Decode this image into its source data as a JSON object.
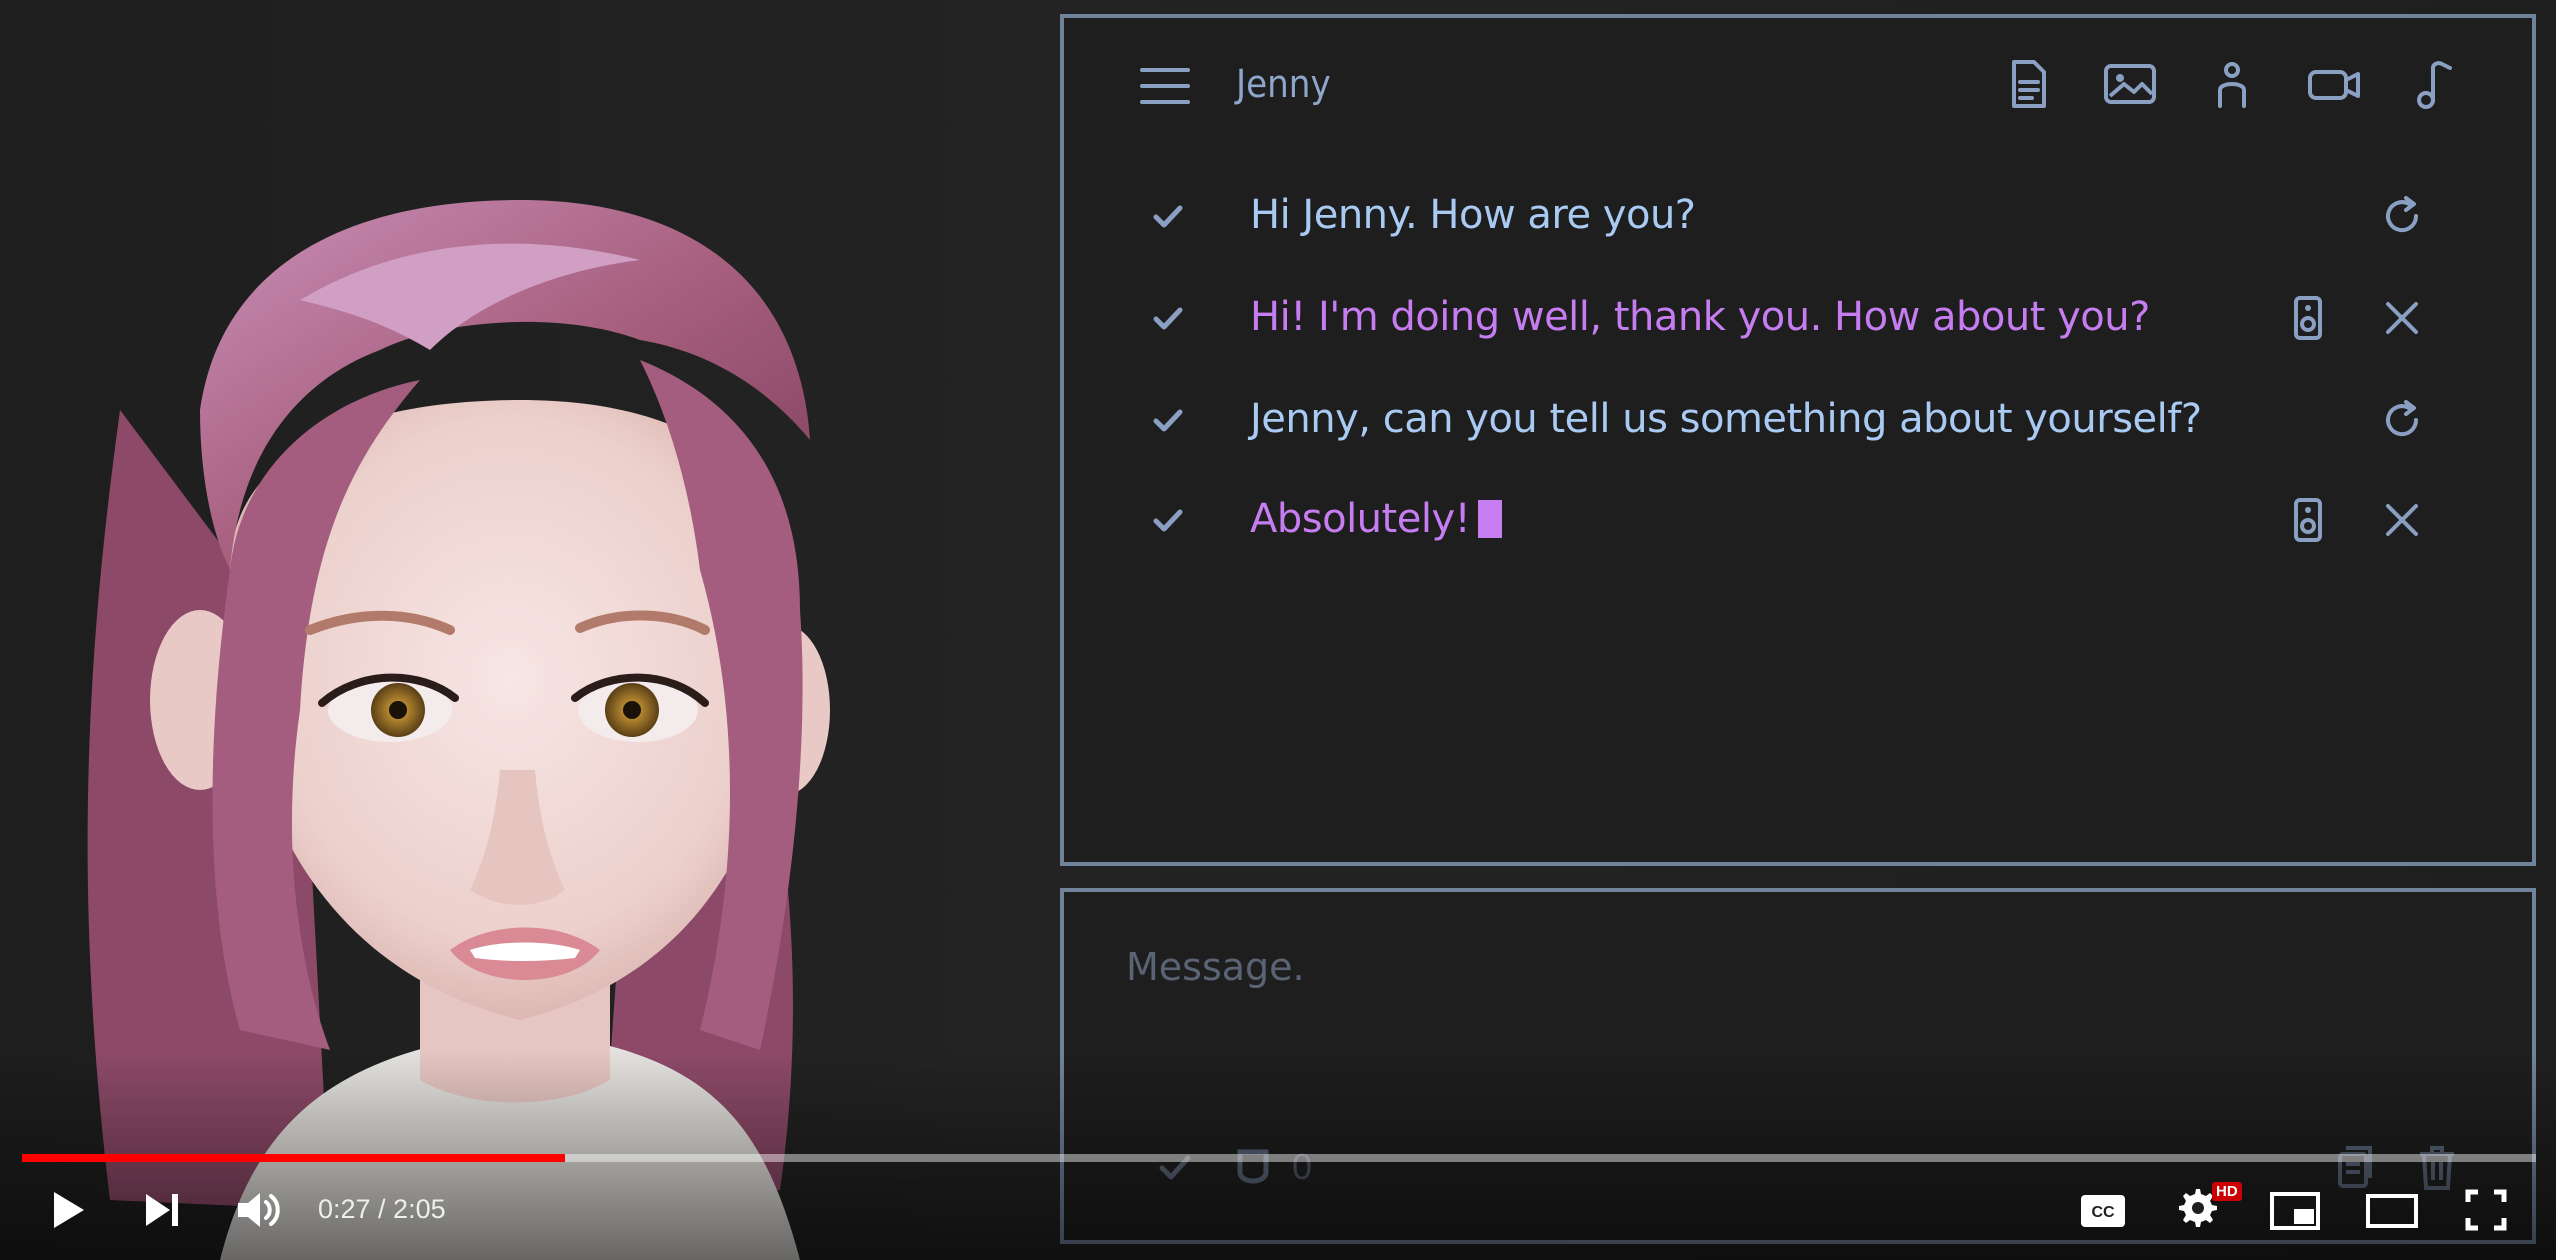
{
  "chat": {
    "title": "Jenny",
    "messages": [
      {
        "role": "user",
        "text": "Hi Jenny. How are you?"
      },
      {
        "role": "bot",
        "text": "Hi! I'm doing well, thank you. How about you?"
      },
      {
        "role": "user",
        "text": "Jenny, can you tell us something about yourself?"
      },
      {
        "role": "bot",
        "text": "Absolutely!"
      }
    ]
  },
  "input": {
    "placeholder": "Message.",
    "count": "0"
  },
  "player": {
    "time": "0:27 / 2:05",
    "progress": 0.216,
    "hd_badge": "HD"
  },
  "colors": {
    "accent_user": "#a9caf2",
    "accent_bot": "#c77df2",
    "panel_border": "#71839b",
    "progress": "#ff0000"
  }
}
